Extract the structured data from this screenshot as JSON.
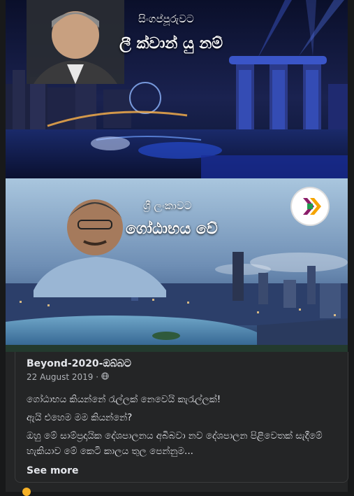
{
  "image_top": {
    "country_line": "සිංගප්පූරුවට",
    "name_line": "ලී ක්වාන් යු නම්"
  },
  "image_bottom": {
    "country_line": "ශ්‍රී ලංකාවට",
    "name_line": "ගෝඨාභය වේ"
  },
  "post": {
    "page_name": "Beyond-2020-ඔබ්බට",
    "date": "22 August 2019 ·",
    "audience_icon": "globe-icon",
    "paragraphs": [
      "ගෝඨාභය කියන්නේ රැල්ලක් නෙවෙයි කැරැල්ලක්!",
      "ඇයි එහෙම මම කියන්නේ?",
      "ඔහු මේ සාම්ප්‍රදායික දේශපාලනය අබිබවා නව දේශපාලන පිළිවෙතක් සැදීමේ හැකියාව මේ කෙටි කාලය තුල පෙන්නුම..."
    ],
    "see_more": "See more"
  }
}
